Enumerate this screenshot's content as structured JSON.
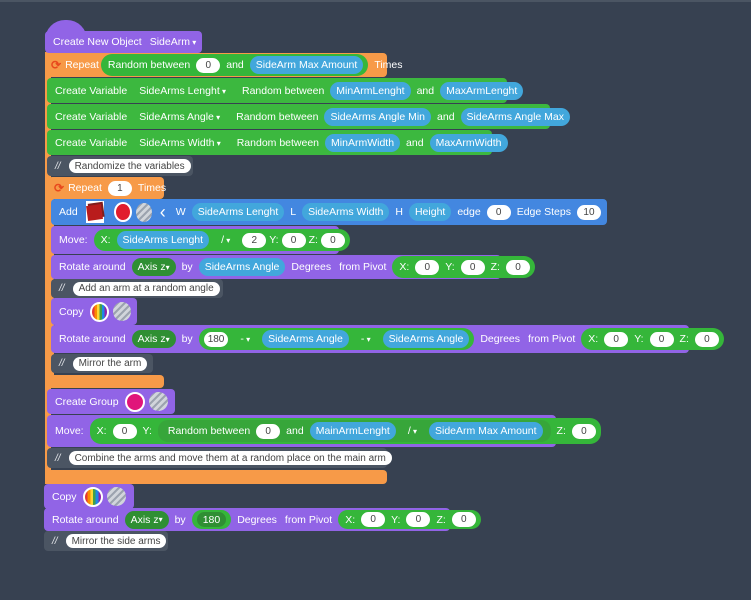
{
  "create_object": {
    "label": "Create New Object",
    "object": "SideArm"
  },
  "repeat1": {
    "label": "Repeat",
    "random_label": "Random between",
    "min": "0",
    "and": "and",
    "max_var": "SideArm Max Amount",
    "times": "Times"
  },
  "vars": [
    {
      "label": "Create Variable",
      "name": "SideArms Lenght",
      "random": "Random between",
      "min": "MinArmLenght",
      "and": "and",
      "max": "MaxArmLenght"
    },
    {
      "label": "Create Variable",
      "name": "SideArms Angle",
      "random": "Random between",
      "min": "SideArms Angle Min",
      "and": "and",
      "max": "SideArms Angle Max"
    },
    {
      "label": "Create Variable",
      "name": "SideArms Width",
      "random": "Random between",
      "min": "MinArmWidth",
      "and": "and",
      "max": "MaxArmWidth"
    }
  ],
  "comments": {
    "c1": "Randomize the variables",
    "c2": "Add an arm at a random angle",
    "c3": "Mirror the arm",
    "c4": "Combine the arms and move them at a random place on the main arm",
    "c5": "Mirror the side arms",
    "slash": "//"
  },
  "repeat2": {
    "label": "Repeat",
    "count": "1",
    "times": "Times"
  },
  "add": {
    "label": "Add",
    "w": "W",
    "w_var": "SideArms Lenght",
    "l": "L",
    "l_var": "SideArms Width",
    "h": "H",
    "h_var": "Height",
    "edge": "edge",
    "edge_val": "0",
    "steps": "Edge Steps",
    "steps_val": "10",
    "color": "#e11d2e"
  },
  "move1": {
    "label": "Move:",
    "x": "X:",
    "x_var": "SideArms Lenght",
    "op": "/",
    "div": "2",
    "y": "Y:",
    "y_val": "0",
    "z": "Z:",
    "z_val": "0"
  },
  "rotate1": {
    "label": "Rotate around",
    "axis": "Axis z",
    "by": "by",
    "angle": "SideArms Angle",
    "degrees": "Degrees",
    "pivot": "from Pivot",
    "x": "X:",
    "xv": "0",
    "y": "Y:",
    "yv": "0",
    "z": "Z:",
    "zv": "0"
  },
  "copy": {
    "label": "Copy"
  },
  "rotate2": {
    "label": "Rotate around",
    "axis": "Axis z",
    "by": "by",
    "num": "180",
    "op1": "-",
    "var1": "SideArms Angle",
    "op2": "-",
    "var2": "SideArms Angle",
    "degrees": "Degrees",
    "pivot": "from Pivot",
    "x": "X:",
    "xv": "0",
    "y": "Y:",
    "yv": "0",
    "z": "Z:",
    "zv": "0"
  },
  "group": {
    "label": "Create Group",
    "color": "#e0157a"
  },
  "move2": {
    "label": "Move:",
    "x": "X:",
    "xv": "0",
    "y": "Y:",
    "random": "Random between",
    "min": "0",
    "and": "and",
    "max_var": "MainArmLenght",
    "op": "/",
    "div_var": "SideArm Max Amount",
    "z": "Z:",
    "zv": "0"
  },
  "copy2": {
    "label": "Copy"
  },
  "rotate3": {
    "label": "Rotate around",
    "axis": "Axis z",
    "by": "by",
    "num": "180",
    "degrees": "Degrees",
    "pivot": "from Pivot",
    "x": "X:",
    "xv": "0",
    "y": "Y:",
    "yv": "0",
    "z": "Z:",
    "zv": "0"
  }
}
